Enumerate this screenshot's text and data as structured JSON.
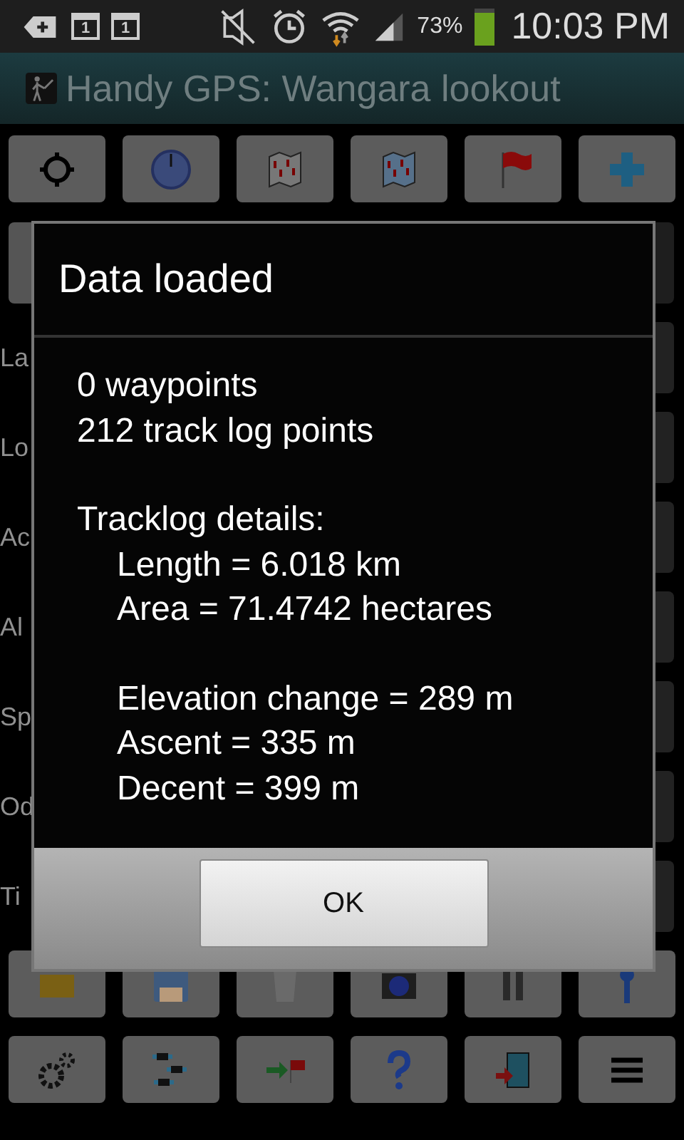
{
  "status_bar": {
    "calendar_days": [
      "1",
      "1"
    ],
    "battery": "73%",
    "time": "10:03 PM"
  },
  "title_bar": {
    "title": "Handy GPS: Wangara lookout"
  },
  "form": {
    "rows": [
      {
        "label": "La"
      },
      {
        "label": "Lo"
      },
      {
        "label": "Ac"
      },
      {
        "label": "Al"
      },
      {
        "label": "Sp"
      },
      {
        "label": "Od"
      },
      {
        "label": "Ti"
      }
    ]
  },
  "dialog": {
    "title": "Data loaded",
    "sections": [
      {
        "lines": [
          "0 waypoints",
          "212 track log points"
        ],
        "indented": false
      },
      {
        "heading": "Tracklog details:",
        "lines": [
          "Length = 6.018 km",
          "Area = 71.4742 hectares"
        ],
        "indented": true
      },
      {
        "lines": [
          "Elevation change = 289 m",
          "Ascent = 335 m",
          "Decent = 399 m"
        ],
        "indented": true
      }
    ],
    "button": "OK"
  }
}
